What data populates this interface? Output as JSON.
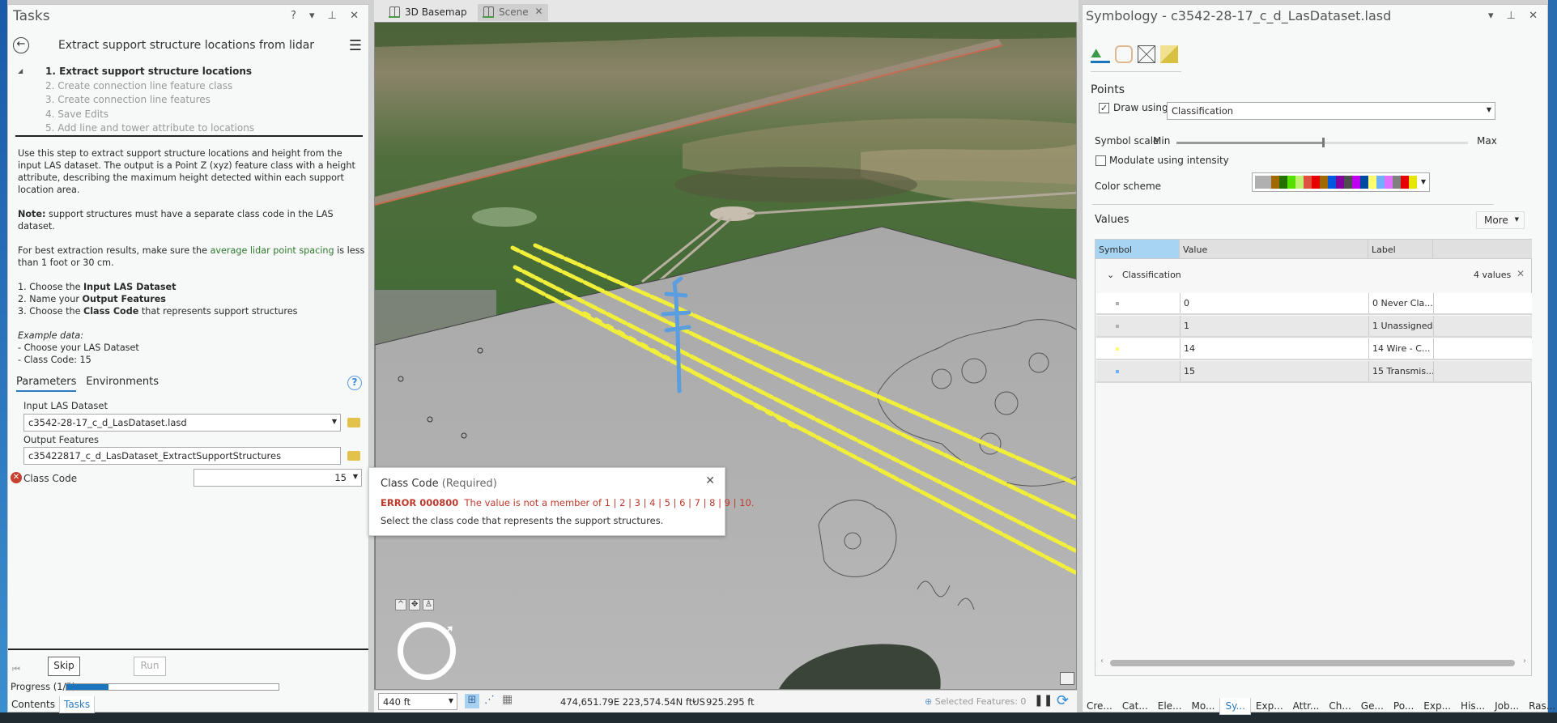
{
  "tasks_pane": {
    "title": "Tasks",
    "window_buttons": "? ▾ ⊥ ✕",
    "task_name": "Extract support structure locations from lidar",
    "steps": [
      "1.  Extract support structure locations",
      "2.  Create connection line feature class",
      "3.  Create connection line features",
      "4.  Save Edits",
      "5.  Add line and tower attribute to locations"
    ],
    "description": {
      "p1": "Use this step to extract support structure locations and height from the input LAS dataset. The output is a Point Z (xyz) feature class with a height attribute, describing the maximum height detected within each support location area.",
      "note_label": "Note:",
      "note_text": " support structures must have a separate class code in the LAS dataset.",
      "p3_a": "For best extraction results, make sure the ",
      "p3_link": "average lidar point spacing",
      "p3_b": " is less than 1 foot or 30 cm.",
      "i1_a": "1. Choose the ",
      "i1_b": "Input LAS Dataset",
      "i2_a": "2. Name your ",
      "i2_b": "Output Features",
      "i3_a": "3. Choose the ",
      "i3_b": "Class Code",
      "i3_c": " that represents support structures",
      "example_label": "Example data:",
      "example_1": "- Choose your LAS Dataset",
      "example_2": "- Class Code: 15"
    },
    "tabs": [
      "Parameters",
      "Environments"
    ],
    "params": {
      "input_las_label": "Input LAS Dataset",
      "input_las_value": "c3542-28-17_c_d_LasDataset.lasd",
      "output_label": "Output Features",
      "output_value": "c35422817_c_d_LasDataset_ExtractSupportStructures",
      "class_code_label": "Class Code",
      "class_code_value": "15"
    },
    "skip_label": "Skip",
    "run_label": "Run",
    "progress_label": "Progress (1/5)",
    "progress_fraction": 0.2,
    "bottom_tabs": [
      "Contents",
      "Tasks"
    ]
  },
  "map_view": {
    "tabs": [
      "3D Basemap",
      "Scene"
    ],
    "scale": "440 ft",
    "coordinates": "474,651.79E 223,574.54N ftUS",
    "elevation": "925.295 ft",
    "selected_features": "Selected Features: 0"
  },
  "error_popup": {
    "title": "Class Code",
    "required": "(Required)",
    "error_code": "ERROR 000800",
    "error_message": "The value is not a member of 1 | 2 | 3 | 4 | 5 | 6 | 7 | 8 | 9 | 10.",
    "hint": "Select the class code that represents the support structures."
  },
  "symbology_pane": {
    "title": "Symbology - c3542-28-17_c_d_LasDataset.lasd",
    "window_buttons": "▾ ⊥ ✕",
    "section_points": "Points",
    "draw_using_label": "Draw using",
    "draw_using_value": "Classification",
    "symbol_scale_label": "Symbol scale",
    "min_label": "Min",
    "max_label": "Max",
    "symbol_scale_fraction": 0.5,
    "modulate_label": "Modulate using intensity",
    "color_scheme_label": "Color scheme",
    "color_scheme": [
      "#b0b0b0",
      "#b0b0b0",
      "#a06a00",
      "#267000",
      "#55e000",
      "#c0f070",
      "#e05040",
      "#e60000",
      "#a06a00",
      "#0058e0",
      "#8000a0",
      "#4e4e4e",
      "#c000f0",
      "#0048a0",
      "#ffff70",
      "#70b0ff",
      "#e070ff",
      "#808080",
      "#e60000",
      "#e6e600"
    ],
    "values_label": "Values",
    "more_label": "More",
    "columns": [
      "Symbol",
      "Value",
      "Label"
    ],
    "group_label": "Classification",
    "group_count": "4 values",
    "rows": [
      {
        "value": "0",
        "label": "0  Never Cla...",
        "color": "#b0b0b0"
      },
      {
        "value": "1",
        "label": "1  Unassigned",
        "color": "#b0b0b0"
      },
      {
        "value": "14",
        "label": "14  Wire - C...",
        "color": "#ffff70"
      },
      {
        "value": "15",
        "label": "15  Transmis...",
        "color": "#70b0ff"
      }
    ],
    "bottom_tabs": [
      "Cre...",
      "Cat...",
      "Ele...",
      "Mo...",
      "Sy...",
      "Exp...",
      "Attr...",
      "Ch...",
      "Ge...",
      "Po...",
      "Exp...",
      "His...",
      "Job...",
      "Ras..."
    ]
  }
}
